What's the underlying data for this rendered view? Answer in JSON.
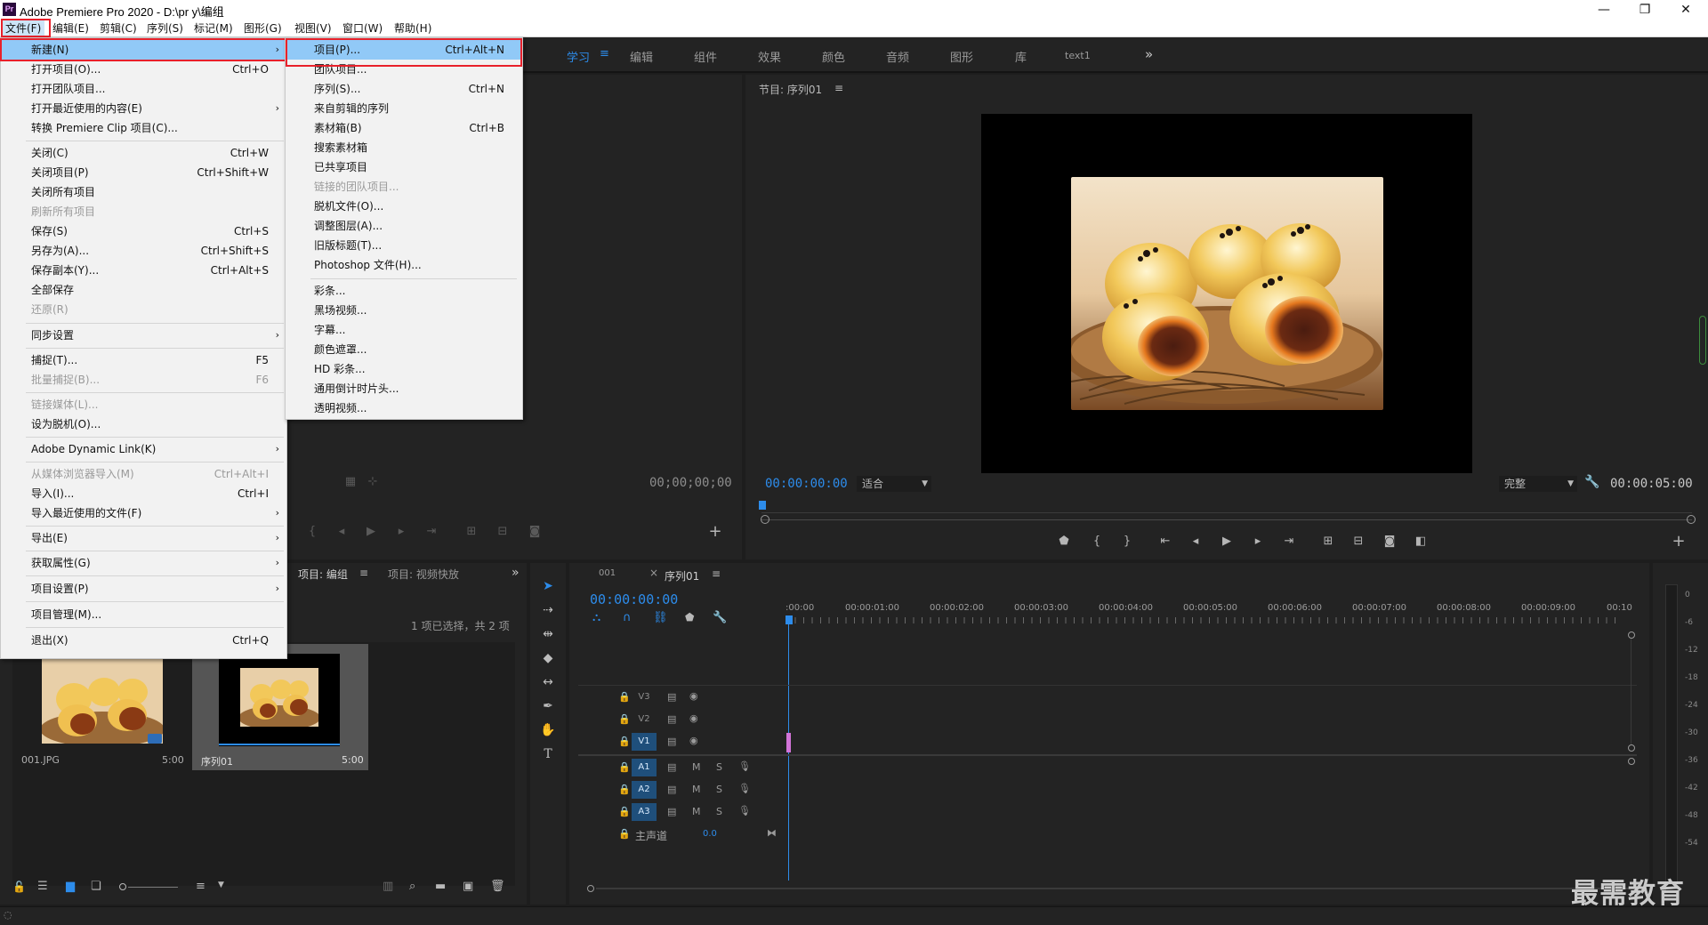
{
  "window": {
    "title": "Adobe Premiere Pro 2020 - D:\\pr y\\编组",
    "app_icon_text": "Pr",
    "minimize": "—",
    "maximize": "❐",
    "close": "✕"
  },
  "menubar": [
    "文件(F)",
    "编辑(E)",
    "剪辑(C)",
    "序列(S)",
    "标记(M)",
    "图形(G)",
    "视图(V)",
    "窗口(W)",
    "帮助(H)"
  ],
  "workspaces": {
    "tabs": [
      "学习",
      "编辑",
      "组件",
      "效果",
      "颜色",
      "音频",
      "图形",
      "库",
      "text1"
    ],
    "menu_glyph": "≡",
    "more": "»"
  },
  "file_menu": [
    {
      "label": "新建(N)",
      "shortcut": "",
      "submenu": true,
      "highlight": true
    },
    {
      "label": "打开项目(O)...",
      "shortcut": "Ctrl+O"
    },
    {
      "label": "打开团队项目...",
      "shortcut": ""
    },
    {
      "label": "打开最近使用的内容(E)",
      "shortcut": "",
      "submenu": true
    },
    {
      "label": "转换 Premiere Clip 项目(C)...",
      "shortcut": ""
    },
    {
      "label": "关闭(C)",
      "shortcut": "Ctrl+W"
    },
    {
      "label": "关闭项目(P)",
      "shortcut": "Ctrl+Shift+W"
    },
    {
      "label": "关闭所有项目",
      "shortcut": ""
    },
    {
      "label": "刷新所有项目",
      "shortcut": "",
      "disabled": true
    },
    {
      "label": "保存(S)",
      "shortcut": "Ctrl+S"
    },
    {
      "label": "另存为(A)...",
      "shortcut": "Ctrl+Shift+S"
    },
    {
      "label": "保存副本(Y)...",
      "shortcut": "Ctrl+Alt+S"
    },
    {
      "label": "全部保存",
      "shortcut": ""
    },
    {
      "label": "还原(R)",
      "shortcut": "",
      "disabled": true
    },
    {
      "label": "同步设置",
      "shortcut": "",
      "submenu": true
    },
    {
      "label": "捕捉(T)...",
      "shortcut": "F5"
    },
    {
      "label": "批量捕捉(B)...",
      "shortcut": "F6",
      "disabled": true
    },
    {
      "label": "链接媒体(L)...",
      "shortcut": "",
      "disabled": true
    },
    {
      "label": "设为脱机(O)...",
      "shortcut": ""
    },
    {
      "label": "Adobe Dynamic Link(K)",
      "shortcut": "",
      "submenu": true
    },
    {
      "label": "从媒体浏览器导入(M)",
      "shortcut": "Ctrl+Alt+I",
      "disabled": true
    },
    {
      "label": "导入(I)...",
      "shortcut": "Ctrl+I"
    },
    {
      "label": "导入最近使用的文件(F)",
      "shortcut": "",
      "submenu": true
    },
    {
      "label": "导出(E)",
      "shortcut": "",
      "submenu": true
    },
    {
      "label": "获取属性(G)",
      "shortcut": "",
      "submenu": true
    },
    {
      "label": "项目设置(P)",
      "shortcut": "",
      "submenu": true
    },
    {
      "label": "项目管理(M)...",
      "shortcut": ""
    },
    {
      "label": "退出(X)",
      "shortcut": "Ctrl+Q"
    }
  ],
  "new_submenu": [
    {
      "label": "项目(P)...",
      "shortcut": "Ctrl+Alt+N",
      "highlight": true
    },
    {
      "label": "团队项目...",
      "shortcut": ""
    },
    {
      "label": "序列(S)...",
      "shortcut": "Ctrl+N"
    },
    {
      "label": "来自剪辑的序列",
      "shortcut": ""
    },
    {
      "label": "素材箱(B)",
      "shortcut": "Ctrl+B"
    },
    {
      "label": "搜索素材箱",
      "shortcut": ""
    },
    {
      "label": "已共享项目",
      "shortcut": ""
    },
    {
      "label": "链接的团队项目...",
      "shortcut": "",
      "disabled": true
    },
    {
      "label": "脱机文件(O)...",
      "shortcut": ""
    },
    {
      "label": "调整图层(A)...",
      "shortcut": ""
    },
    {
      "label": "旧版标题(T)...",
      "shortcut": ""
    },
    {
      "label": "Photoshop 文件(H)...",
      "shortcut": ""
    },
    {
      "label": "彩条...",
      "shortcut": ""
    },
    {
      "label": "黑场视频...",
      "shortcut": ""
    },
    {
      "label": "字幕...",
      "shortcut": ""
    },
    {
      "label": "颜色遮罩...",
      "shortcut": ""
    },
    {
      "label": "HD 彩条...",
      "shortcut": ""
    },
    {
      "label": "通用倒计时片头...",
      "shortcut": ""
    },
    {
      "label": "透明视频...",
      "shortcut": ""
    }
  ],
  "source_monitor": {
    "timecode": "00;00;00;00"
  },
  "program_monitor": {
    "title": "节目: 序列01",
    "menu_glyph": "≡",
    "timecode": "00:00:00:00",
    "fit": "适合",
    "quality": "完整",
    "duration": "00:00:05:00"
  },
  "project_panel": {
    "tab_project": "项目: 编组",
    "tab_other": "项目: 视频快放",
    "selection_info": "1 项已选择，共 2 项",
    "items": [
      {
        "name": "001.JPG",
        "duration": "5:00"
      },
      {
        "name": "序列01",
        "duration": "5:00"
      }
    ]
  },
  "timeline": {
    "tab_001": "001",
    "tab_seq": "序列01",
    "close_glyph": "×",
    "timecode": "00:00:00:00",
    "ruler": [
      ":00:00",
      "00:00:01:00",
      "00:00:02:00",
      "00:00:03:00",
      "00:00:04:00",
      "00:00:05:00",
      "00:00:06:00",
      "00:00:07:00",
      "00:00:08:00",
      "00:00:09:00",
      "00:10"
    ],
    "video_tracks": [
      "V3",
      "V2",
      "V1"
    ],
    "audio_tracks": [
      "A1",
      "A2",
      "A3"
    ],
    "mute": "M",
    "solo": "S",
    "master": "主声道",
    "master_value": "0.0"
  },
  "audio_meter": {
    "labels": [
      "0",
      "-6",
      "-12",
      "-18",
      "-24",
      "-30",
      "-36",
      "-42",
      "-48",
      "-54"
    ]
  },
  "watermark": "最需教育",
  "colors": {
    "accent_blue": "#2d8ceb",
    "menu_highlight": "#91c9f7",
    "callout_red": "#e8212b",
    "track_on": "#1f4f7b"
  }
}
